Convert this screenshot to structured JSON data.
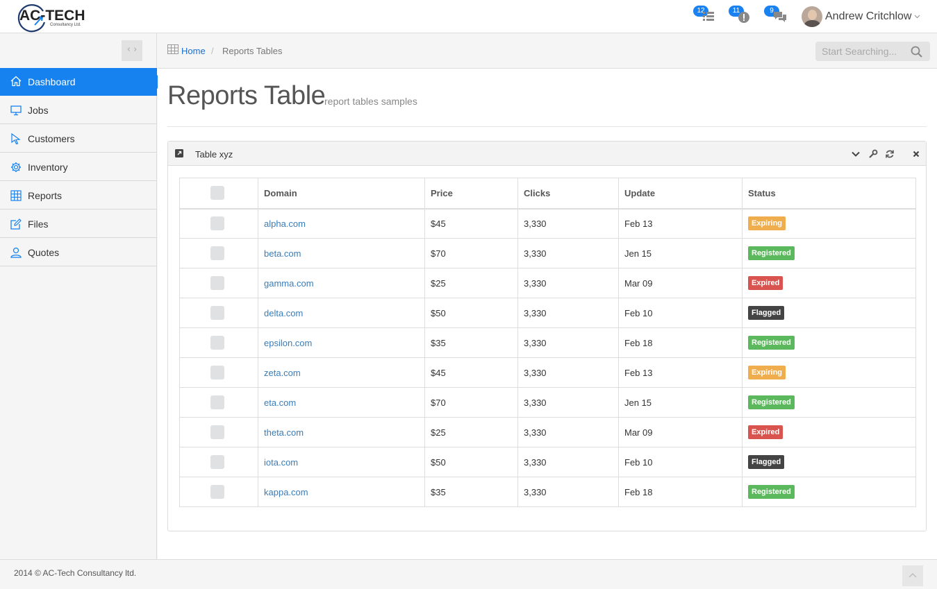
{
  "brand": {
    "name": "AC-TECH",
    "tagline": "Consultancy Ltd."
  },
  "header": {
    "notifications": [
      {
        "icon": "tasks-list-icon",
        "count": "12"
      },
      {
        "icon": "alert-icon",
        "count": "11"
      },
      {
        "icon": "chat-icon",
        "count": "9"
      }
    ],
    "user_name": "Andrew Critchlow"
  },
  "sidebar": {
    "items": [
      {
        "label": "Dashboard",
        "icon": "home-icon",
        "active": true
      },
      {
        "label": "Jobs",
        "icon": "monitor-icon"
      },
      {
        "label": "Customers",
        "icon": "cursor-icon"
      },
      {
        "label": "Inventory",
        "icon": "gear-icon"
      },
      {
        "label": "Reports",
        "icon": "grid-icon"
      },
      {
        "label": "Files",
        "icon": "edit-icon"
      },
      {
        "label": "Quotes",
        "icon": "user-icon"
      }
    ]
  },
  "breadcrumb": {
    "home": "Home",
    "separator": "/",
    "current": "Reports Tables"
  },
  "search": {
    "placeholder": "Start Searching..."
  },
  "page": {
    "title": "Reports Table",
    "subtitle": "report tables samples"
  },
  "panel": {
    "title": "Table xyz",
    "columns": [
      "",
      "Domain",
      "Price",
      "Clicks",
      "Update",
      "Status"
    ],
    "rows": [
      {
        "domain": "alpha.com",
        "price": "$45",
        "clicks": "3,330",
        "update": "Feb 13",
        "status": "Expiring"
      },
      {
        "domain": "beta.com",
        "price": "$70",
        "clicks": "3,330",
        "update": "Jen 15",
        "status": "Registered"
      },
      {
        "domain": "gamma.com",
        "price": "$25",
        "clicks": "3,330",
        "update": "Mar 09",
        "status": "Expired"
      },
      {
        "domain": "delta.com",
        "price": "$50",
        "clicks": "3,330",
        "update": "Feb 10",
        "status": "Flagged"
      },
      {
        "domain": "epsilon.com",
        "price": "$35",
        "clicks": "3,330",
        "update": "Feb 18",
        "status": "Registered"
      },
      {
        "domain": "zeta.com",
        "price": "$45",
        "clicks": "3,330",
        "update": "Feb 13",
        "status": "Expiring"
      },
      {
        "domain": "eta.com",
        "price": "$70",
        "clicks": "3,330",
        "update": "Jen 15",
        "status": "Registered"
      },
      {
        "domain": "theta.com",
        "price": "$25",
        "clicks": "3,330",
        "update": "Mar 09",
        "status": "Expired"
      },
      {
        "domain": "iota.com",
        "price": "$50",
        "clicks": "3,330",
        "update": "Feb 10",
        "status": "Flagged"
      },
      {
        "domain": "kappa.com",
        "price": "$35",
        "clicks": "3,330",
        "update": "Feb 18",
        "status": "Registered"
      }
    ]
  },
  "status_colors": {
    "Expiring": "#f0ad4e",
    "Registered": "#5cb85c",
    "Expired": "#d9534f",
    "Flagged": "#444444"
  },
  "colors": {
    "accent": "#1582f0",
    "link": "#3a7cb8"
  },
  "footer": {
    "text": "2014 © AC-Tech Consultancy ltd."
  }
}
